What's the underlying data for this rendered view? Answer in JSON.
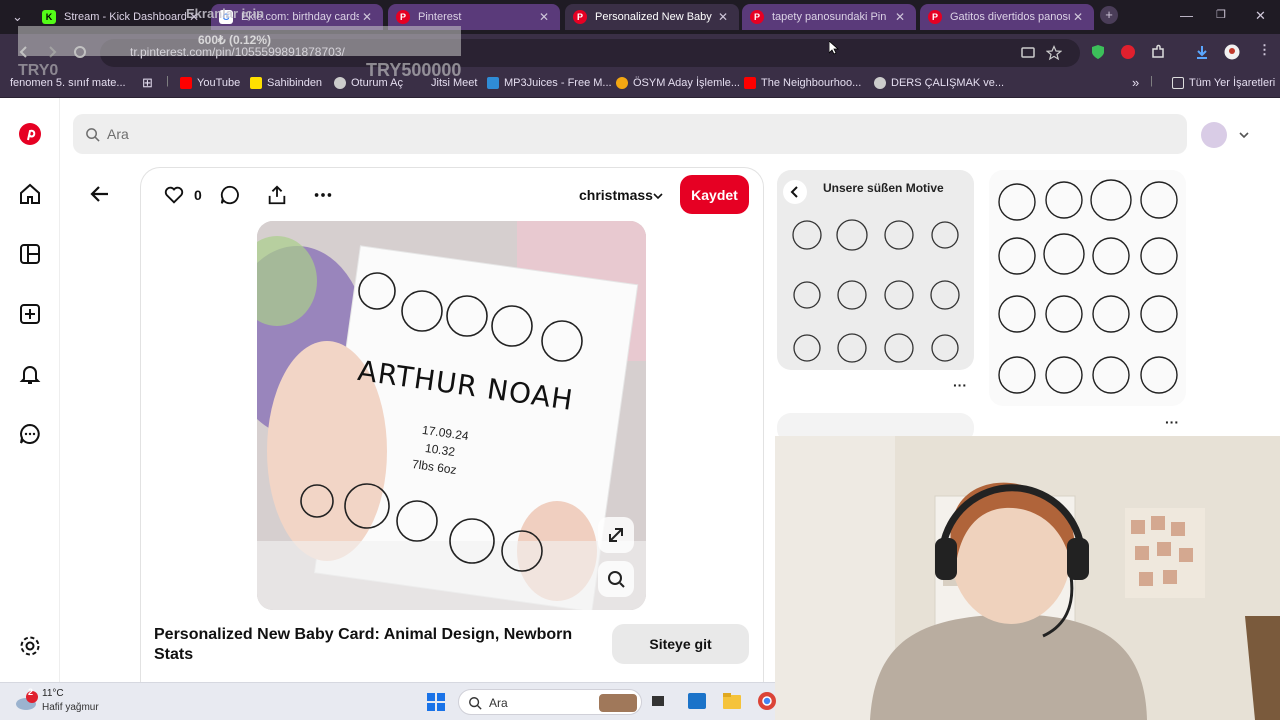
{
  "tabs": [
    {
      "title": "Stream - Kick Dashboard",
      "favicon": "kick-icon"
    },
    {
      "title": "Ekle.com: birthday cards",
      "favicon": "google-icon"
    },
    {
      "title": "Pinterest",
      "favicon": "pinterest-icon"
    },
    {
      "title": "Personalized New Baby Ca",
      "favicon": "pinterest-icon"
    },
    {
      "title": "tapety panosundaki Pin",
      "favicon": "pinterest-icon"
    },
    {
      "title": "Gatitos divertidos panosu",
      "favicon": "pinterest-icon"
    }
  ],
  "omnibox": {
    "url": "tr.pinterest.com/pin/1055599891878703/"
  },
  "bookmarks": [
    "fenomen 5. sınıf mate...",
    "YouTube",
    "Sahibinden",
    "Oturum Aç",
    "Jitsi Meet",
    "MP3Juices - Free M...",
    "ÖSYM Aday İşlemle...",
    "The Neighbourhoo...",
    "DERS ÇALIŞMAK ve..."
  ],
  "bookmarks_all": "Tüm Yer İşaretleri",
  "overlay": {
    "title": "Ekranlar için",
    "progress": "600₺ (0.12%)",
    "left_value": "TRY0",
    "right_value": "TRY500000"
  },
  "search": {
    "placeholder": "Ara"
  },
  "pin": {
    "likes": "0",
    "board": "christmass",
    "save_label": "Kaydet",
    "card_name": "ARTHUR NOAH",
    "card_date": "17.09.24",
    "card_time": "10.32",
    "card_weight": "7lbs 6oz",
    "title": "Personalized New Baby Card: Animal Design, Newborn Stats",
    "visit_label": "Siteye git"
  },
  "related": {
    "first_title": "Unsere süßen Motive"
  },
  "taskbar": {
    "notif_count": "2",
    "temp": "11°C",
    "weather": "Hafif yağmur",
    "search_placeholder": "Ara"
  }
}
